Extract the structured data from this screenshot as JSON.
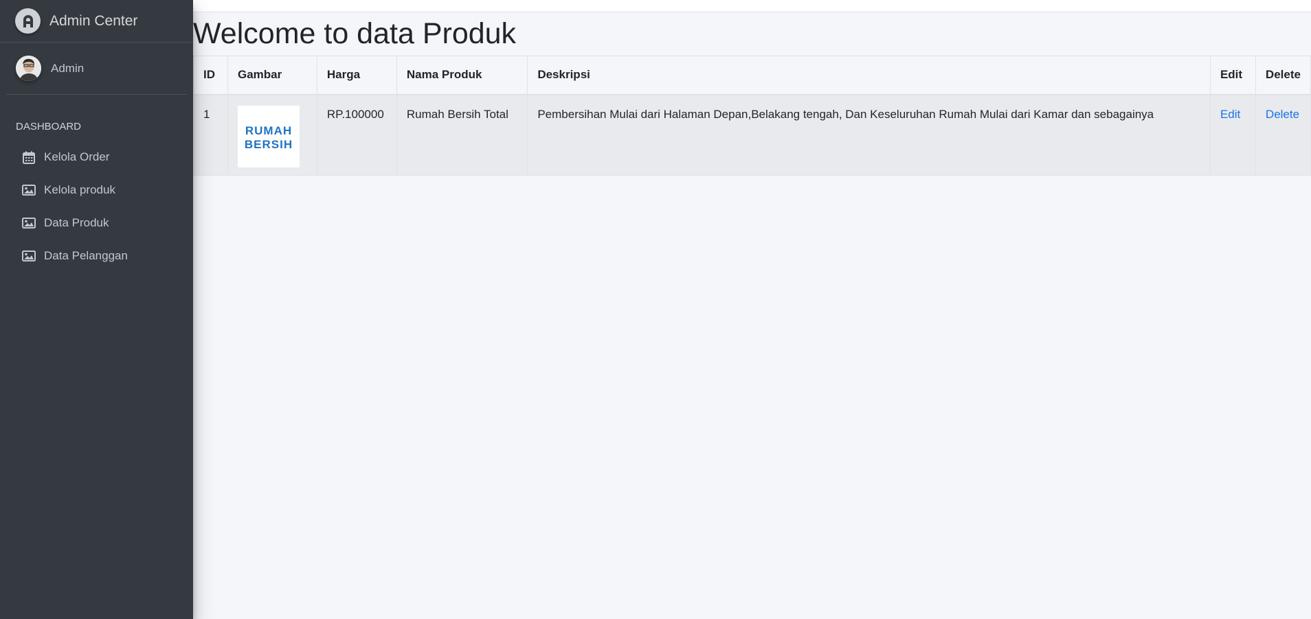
{
  "brand": {
    "title": "Admin Center"
  },
  "user": {
    "name": "Admin"
  },
  "nav": {
    "header": "DASHBOARD",
    "items": [
      {
        "label": "Kelola Order",
        "icon": "calendar-icon"
      },
      {
        "label": "Kelola produk",
        "icon": "image-icon"
      },
      {
        "label": "Data Produk",
        "icon": "image-icon"
      },
      {
        "label": "Data Pelanggan",
        "icon": "image-icon"
      }
    ]
  },
  "page": {
    "title": "Welcome to data Produk"
  },
  "table": {
    "headers": [
      "ID",
      "Gambar",
      "Harga",
      "Nama Produk",
      "Deskripsi",
      "Edit",
      "Delete"
    ],
    "rows": [
      {
        "id": "1",
        "image_text": [
          "RUMAH",
          "BERSIH"
        ],
        "harga": "RP.100000",
        "nama": "Rumah Bersih Total",
        "deskripsi": "Pembersihan Mulai dari Halaman Depan,Belakang tengah, Dan Keseluruhan Rumah Mulai dari Kamar dan sebagainya",
        "edit": "Edit",
        "delete": "Delete"
      }
    ]
  },
  "colors": {
    "sidebar": "#343a40",
    "content_bg": "#f4f6f9",
    "link": "#1a73e8",
    "logo_blue": "#1f73c4"
  }
}
